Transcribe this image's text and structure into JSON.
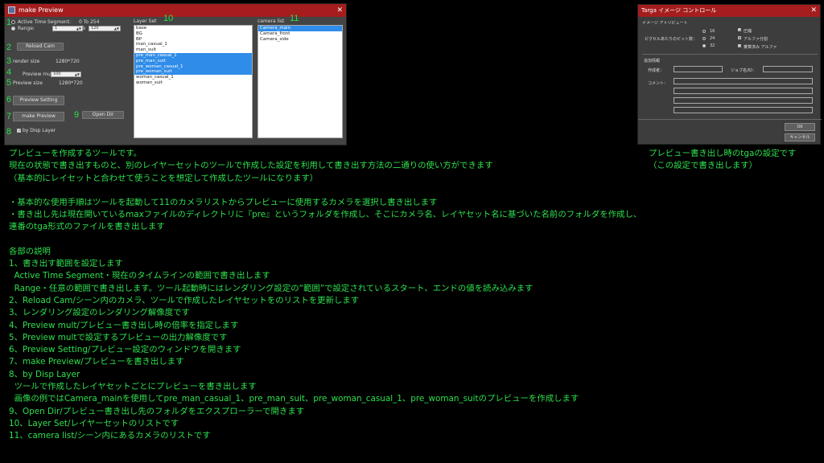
{
  "make_preview": {
    "title": "make Preview",
    "close": "✕",
    "active_time_segment": "Active Time Segment:",
    "active_range_value": "0 To 254",
    "range_label": "Range:",
    "range_from": "1",
    "range_to_label": "To",
    "range_to": "120",
    "reload_cam": "Reload Cam",
    "render_size_label": "render size",
    "render_size_value": "1280*720",
    "preview_mult_label": "Preview mult",
    "preview_mult_value": "100",
    "preview_size_label": "Preview size",
    "preview_size_value": "1280*720",
    "preview_setting": "Preview Setting",
    "make_preview_btn": "make Preview",
    "open_dir": "Open Dir",
    "by_disp_layer": "by Disp Layer",
    "layer_set_label": "Layer Set",
    "camera_list_label": "camera list",
    "layer_set_items": [
      {
        "name": "base",
        "selected": false
      },
      {
        "name": "BG",
        "selected": false
      },
      {
        "name": "BP",
        "selected": false
      },
      {
        "name": "man_casual_1",
        "selected": false
      },
      {
        "name": "man_suit",
        "selected": false
      },
      {
        "name": "pre_man_casual_1",
        "selected": true
      },
      {
        "name": "pre_man_suit",
        "selected": true
      },
      {
        "name": "pre_woman_casual_1",
        "selected": true
      },
      {
        "name": "pre_woman_suit",
        "selected": true
      },
      {
        "name": "woman_casual_1",
        "selected": false
      },
      {
        "name": "woman_suit",
        "selected": false
      }
    ],
    "camera_items": [
      {
        "name": "Camera_main",
        "selected": true
      },
      {
        "name": "Camera_front",
        "selected": false
      },
      {
        "name": "Camera_side",
        "selected": false
      }
    ],
    "numbers": [
      "1",
      "2",
      "3",
      "4",
      "5",
      "6",
      "7",
      "8",
      "9",
      "10",
      "11"
    ]
  },
  "targa": {
    "title": "Targa イメージ コントロール",
    "close": "✕",
    "image_attr": "イメージ アトリビュート",
    "bits_label": "ピクセルあたりのビット数：",
    "bits": [
      "16",
      "24",
      "32"
    ],
    "compress": "圧縮",
    "alpha_split": "アルファ分割",
    "premult_alpha": "乗算済み アルファ",
    "extra_info": "追加情報",
    "author": "作成者：",
    "job_name": "ジョブ名/ID：",
    "comment": "コメント：",
    "ok": "OK",
    "cancel": "キャンセル"
  },
  "targa_desc": [
    "プレビュー書き出し時のtgaの設定です",
    "（この設定で書き出します）"
  ],
  "main_desc": [
    "プレビューを作成するツールです。",
    "現在の状態で書き出すものと、別のレイヤーセットのツールで作成した設定を利用して書き出す方法の二通りの使い方ができます",
    "（基本的にレイセットと合わせて使うことを想定して作成したツールになります）",
    "",
    "・基本的な使用手順はツールを起動して11のカメラリストからプレビューに使用するカメラを選択し書き出します",
    "・書き出し先は現在開いているmaxファイルのディレクトリに『pre』というフォルダを作成し、そこにカメラ名、レイヤセット名に基づいた名前のフォルダを作成し、",
    "連番のtga形式のファイルを書き出します",
    "",
    "各部の説明",
    "1、書き出す範囲を設定します",
    "  Active Time Segment・現在のタイムラインの範囲で書き出します",
    "  Range・任意の範囲で書き出します。ツール起動時にはレンダリング設定の“範囲”で設定されているスタート、エンドの値を読み込みます",
    "2、Reload Cam/シーン内のカメラ、ツールで作成したレイヤセットをのリストを更新します",
    "3、レンダリング設定のレンダリング解像度です",
    "4、Preview mult/プレビュー書き出し時の倍率を指定します",
    "5、Preview multで設定するプレビューの出力解像度です",
    "6、Preview Setting/プレビュー設定のウィンドウを開きます",
    "7、make Preview/プレビューを書き出します",
    "8、by Disp Layer",
    "  ツールで作成したレイヤセットごとにプレビューを書き出します",
    "  画像の例ではCamera_mainを使用してpre_man_casual_1、pre_man_suit、pre_woman_casual_1、pre_woman_suitのプレビューを作成します",
    "9、Open Dir/プレビュー書き出し先のフォルダをエクスプローラーで開きます",
    "10、Layer Set/レイヤーセットのリストです",
    "11、camera list/シーン内にあるカメラのリストです"
  ]
}
